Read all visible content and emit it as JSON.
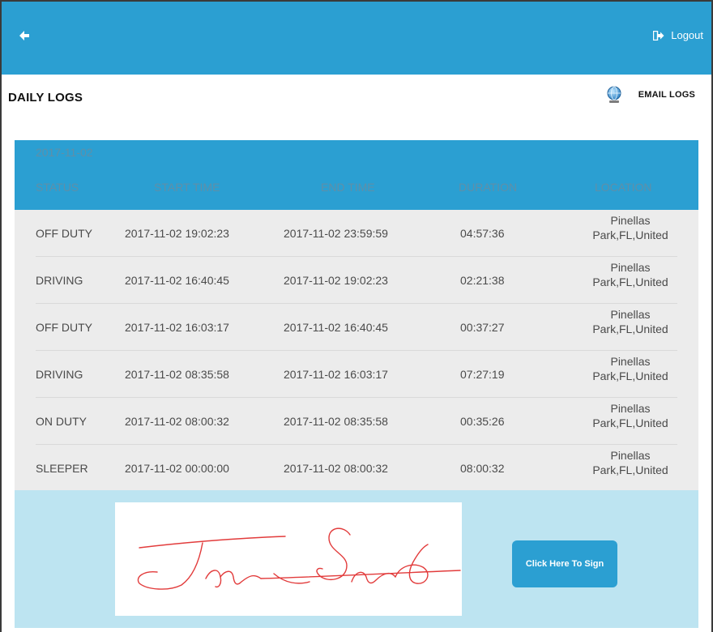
{
  "theme": {
    "accent": "#2b9fd2",
    "sign_area_bg": "#bde4f1",
    "signature_color": "#e23b3b"
  },
  "topbar": {
    "back_icon": "arrow-left-icon",
    "logout_label": "Logout",
    "logout_icon": "logout-icon"
  },
  "header": {
    "title": "DAILY LOGS",
    "email_label": "EMAIL LOGS",
    "email_icon": "globe-icon"
  },
  "log": {
    "date": "2017-11-02",
    "columns": [
      "STATUS",
      "START TIME",
      "END TIME",
      "DURATION",
      "LOCATION"
    ],
    "rows": [
      {
        "status": "OFF DUTY",
        "start": "2017-11-02 19:02:23",
        "end": "2017-11-02 23:59:59",
        "duration": "04:57:36",
        "loc1": "Pinellas",
        "loc2": "Park,FL,United"
      },
      {
        "status": "DRIVING",
        "start": "2017-11-02 16:40:45",
        "end": "2017-11-02 19:02:23",
        "duration": "02:21:38",
        "loc1": "Pinellas",
        "loc2": "Park,FL,United"
      },
      {
        "status": "OFF DUTY",
        "start": "2017-11-02 16:03:17",
        "end": "2017-11-02 16:40:45",
        "duration": "00:37:27",
        "loc1": "Pinellas",
        "loc2": "Park,FL,United"
      },
      {
        "status": "DRIVING",
        "start": "2017-11-02 08:35:58",
        "end": "2017-11-02 16:03:17",
        "duration": "07:27:19",
        "loc1": "Pinellas",
        "loc2": "Park,FL,United"
      },
      {
        "status": "ON DUTY",
        "start": "2017-11-02 08:00:32",
        "end": "2017-11-02 08:35:58",
        "duration": "00:35:26",
        "loc1": "Pinellas",
        "loc2": "Park,FL,United"
      },
      {
        "status": "SLEEPER",
        "start": "2017-11-02 00:00:00",
        "end": "2017-11-02 08:00:32",
        "duration": "08:00:32",
        "loc1": "Pinellas",
        "loc2": "Park,FL,United"
      }
    ]
  },
  "signature": {
    "button_label": "Click Here To Sign"
  }
}
